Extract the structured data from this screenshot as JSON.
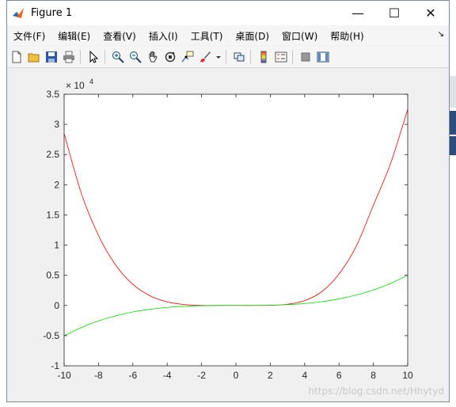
{
  "window": {
    "title": "Figure 1",
    "minimize_glyph": "—",
    "maximize_glyph": "☐",
    "close_glyph": "✕"
  },
  "menu": {
    "items": [
      {
        "label": "文件(F)",
        "name": "file"
      },
      {
        "label": "编辑(E)",
        "name": "edit"
      },
      {
        "label": "查看(V)",
        "name": "view"
      },
      {
        "label": "插入(I)",
        "name": "insert"
      },
      {
        "label": "工具(T)",
        "name": "tools"
      },
      {
        "label": "桌面(D)",
        "name": "desktop"
      },
      {
        "label": "窗口(W)",
        "name": "window"
      },
      {
        "label": "帮助(H)",
        "name": "help"
      }
    ],
    "dock_arrow": "↘"
  },
  "toolbar": {
    "icons": [
      "new-figure-icon",
      "open-file-icon",
      "save-icon",
      "print-icon",
      "edit-plot-arrow-icon",
      "zoom-in-icon",
      "zoom-out-icon",
      "pan-hand-icon",
      "rotate-3d-icon",
      "data-cursor-icon",
      "brush-icon",
      "link-plot-icon",
      "colorbar-icon",
      "legend-icon",
      "hide-plot-tools-icon",
      "show-plot-tools-icon"
    ]
  },
  "chart_data": {
    "type": "line",
    "xlim": [
      -10,
      10
    ],
    "ylim": [
      -10000,
      35000
    ],
    "y_exponent_label": "× 10",
    "y_exponent": "4",
    "xticks": [
      -10,
      -8,
      -6,
      -4,
      -2,
      0,
      2,
      4,
      6,
      8,
      10
    ],
    "yticks": [
      -1,
      -0.5,
      0,
      0.5,
      1,
      1.5,
      2,
      2.5,
      3,
      3.5
    ],
    "grid": false,
    "series": [
      {
        "color": "#ff0000",
        "x": [
          -10,
          -9,
          -8,
          -7,
          -6,
          -5,
          -4,
          -3,
          -2,
          -1,
          0,
          1,
          2,
          3,
          4,
          5,
          6,
          7,
          8,
          9,
          10
        ],
        "y": [
          28500,
          18600,
          11600,
          6700,
          3500,
          1600,
          600,
          150,
          20,
          1,
          0,
          1,
          30,
          200,
          800,
          2300,
          5200,
          9800,
          16600,
          23500,
          32500
        ]
      },
      {
        "color": "#00e000",
        "x": [
          -10,
          -9,
          -8,
          -7,
          -6,
          -5,
          -4,
          -3,
          -2,
          -1,
          0,
          1,
          2,
          3,
          4,
          5,
          6,
          7,
          8,
          9,
          10
        ],
        "y": [
          -5000,
          -3650,
          -2560,
          -1720,
          -1080,
          -625,
          -320,
          -135,
          -40,
          -5,
          0,
          5,
          40,
          135,
          320,
          625,
          1080,
          1720,
          2560,
          3650,
          5000
        ]
      }
    ]
  },
  "watermark": "https://blog.csdn.net/Hhytyd"
}
